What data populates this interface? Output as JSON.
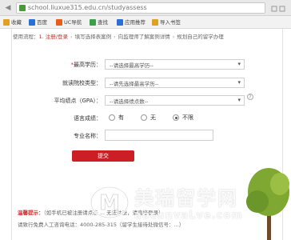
{
  "browser": {
    "url": "school.liuxue315.edu.cn/studyassess"
  },
  "bookmarks": [
    {
      "label": "收藏",
      "color": "#e0a020"
    },
    {
      "label": "百度",
      "color": "#2a6fd6"
    },
    {
      "label": "UC导航",
      "color": "#e85c1c"
    },
    {
      "label": "查找",
      "color": "#3aa14a"
    },
    {
      "label": "应用推荐",
      "color": "#2a6fd6"
    },
    {
      "label": "导入书签",
      "color": "#e0a020"
    }
  ],
  "breadcrumb": {
    "prefix": "使用流程：",
    "step1": "1. 注册/登录",
    "step2": "填写选择表案例",
    "step3": "向监理师了解案例详情",
    "step4": "规划自己的留学办理"
  },
  "form": {
    "required_mark": "*",
    "degree": {
      "label": "最高学历：",
      "value": "--请选择最高学历--"
    },
    "school_type": {
      "label": "就读院校类型：",
      "value": "--请先选择最高学历--"
    },
    "gpa": {
      "label": "平均绩点（GPA）：",
      "value": "--请选择绩点数--",
      "help": "?"
    },
    "language": {
      "label": "语言成绩：",
      "options": [
        "有",
        "无",
        "不限"
      ],
      "selected": 2
    },
    "major": {
      "label": "专业名称：",
      "value": ""
    },
    "submit_label": "提交"
  },
  "tips": {
    "title": "温馨提示：",
    "line1": "（如手机已被注册请点击 ... 无法注册，请直接登录）",
    "line2": "请致行免费人工咨询电话：4000-285-315（留学生接待处微信号：...）"
  },
  "watermark": {
    "logo_letter": "M",
    "cn": "美瑞留学网",
    "en": "aocunvaLve.com"
  }
}
